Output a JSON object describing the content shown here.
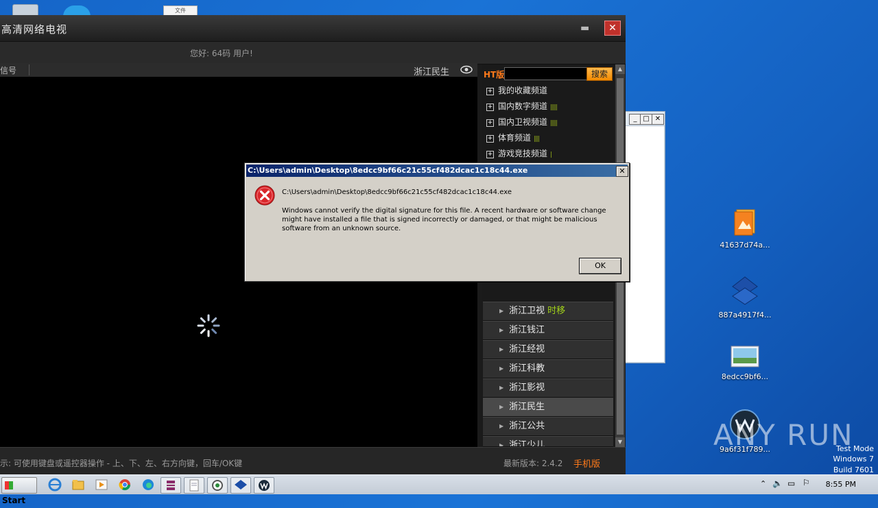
{
  "desktop_top": {
    "doc_icon_text": "文件"
  },
  "app": {
    "title": "高清网络电视",
    "greeting": "您好: 64码 用户!",
    "video_header_label": "信号",
    "current_channel": "浙江民生",
    "search_prefix": "HT版",
    "search_button": "搜索",
    "categories": [
      {
        "label": "我的收藏频道",
        "bars": ""
      },
      {
        "label": "国内数字频道",
        "bars": "|||||"
      },
      {
        "label": "国内卫视频道",
        "bars": "|||||"
      },
      {
        "label": "体育频道",
        "bars": "||||"
      },
      {
        "label": "游戏竞技频道",
        "bars": "|"
      }
    ],
    "channels": [
      {
        "label": "浙江卫视",
        "extra": "时移"
      },
      {
        "label": "浙江钱江",
        "extra": ""
      },
      {
        "label": "浙江经视",
        "extra": ""
      },
      {
        "label": "浙江科教",
        "extra": ""
      },
      {
        "label": "浙江影视",
        "extra": ""
      },
      {
        "label": "浙江民生",
        "extra": ""
      },
      {
        "label": "浙江公共",
        "extra": ""
      },
      {
        "label": "浙江少儿",
        "extra": ""
      }
    ],
    "footer_tip": "示: 可使用键盘或遥控器操作 - 上、下、左、右方向键，回车/OK键",
    "version_text": "最新版本: 2.4.2",
    "mobile_link": "手机版"
  },
  "dialog": {
    "title": "C:\\Users\\admin\\Desktop\\8edcc9bf66c21c55cf482dcac1c18c44.exe",
    "path": "C:\\Users\\admin\\Desktop\\8edcc9bf66c21c55cf482dcac1c18c44.exe",
    "message": "Windows cannot verify the digital signature for this file. A recent hardware or software change might have installed a file that is signed incorrectly or damaged, or that might be malicious software from an unknown source.",
    "ok_label": "OK",
    "close_label": "✕"
  },
  "desktop_icons": [
    {
      "label": "41637d74a...",
      "icon": "image-file-icon"
    },
    {
      "label": "887a4917f4...",
      "icon": "blue-app-icon"
    },
    {
      "label": "8edcc9bf6...",
      "icon": "picture-icon"
    },
    {
      "label": "9a6f31f789...",
      "icon": "media-player-icon"
    }
  ],
  "watermark": "ANY  RUN",
  "test_mode": {
    "line1": "Test Mode",
    "line2": "Windows 7",
    "line3": "Build 7601"
  },
  "taskbar": {
    "start_label": "Start",
    "clock": "8:55 PM"
  },
  "colors": {
    "accent_orange": "#ff7a1a",
    "bars_green": "#9ab61a",
    "timeshift_green": "#a2d21a",
    "dialog_title": "#0a246a",
    "error_red": "#d9262b"
  }
}
